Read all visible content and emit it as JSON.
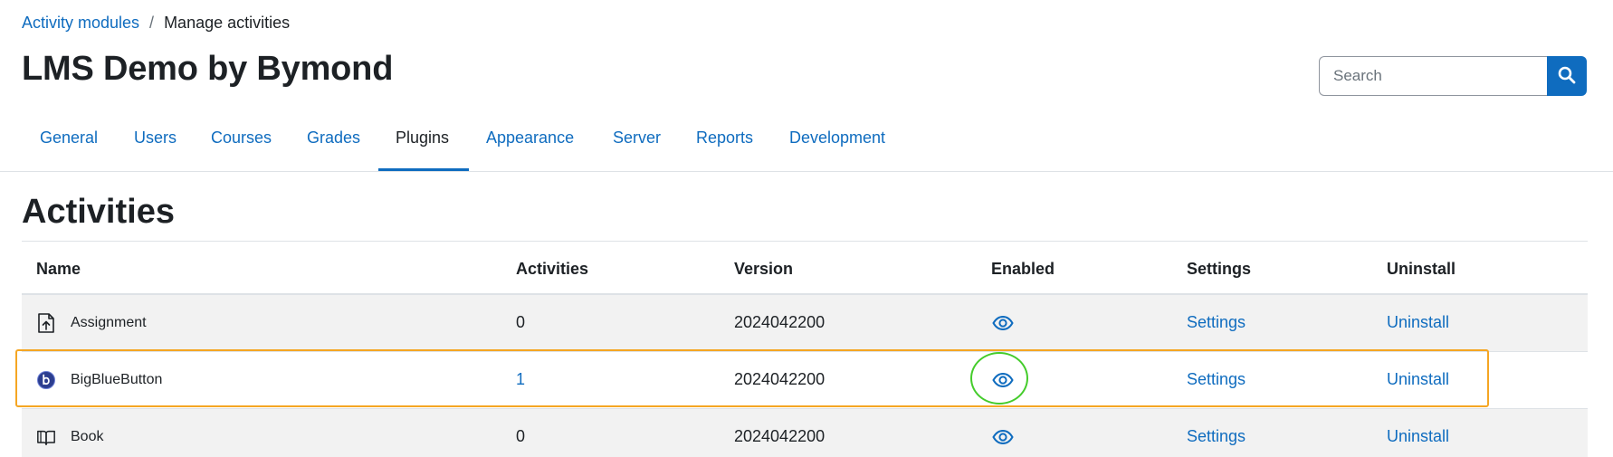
{
  "breadcrumb": {
    "items": [
      {
        "label": "Activity modules"
      },
      {
        "label": "Manage activities"
      }
    ],
    "separator": "/"
  },
  "page_title": "LMS Demo by Bymond",
  "search": {
    "placeholder": "Search",
    "icon": "search-icon"
  },
  "tabs": [
    {
      "label": "General"
    },
    {
      "label": "Users"
    },
    {
      "label": "Courses"
    },
    {
      "label": "Grades"
    },
    {
      "label": "Plugins",
      "active": true
    },
    {
      "label": "Appearance"
    },
    {
      "label": "Server"
    },
    {
      "label": "Reports"
    },
    {
      "label": "Development"
    }
  ],
  "section_title": "Activities",
  "table": {
    "columns": [
      "Name",
      "Activities",
      "Version",
      "Enabled",
      "Settings",
      "Uninstall"
    ],
    "rows": [
      {
        "name": "Assignment",
        "icon": "assignment-icon",
        "activities": "0",
        "version": "2024042200",
        "enabled_icon": "eye-icon",
        "settings": "Settings",
        "uninstall": "Uninstall"
      },
      {
        "name": "BigBlueButton",
        "icon": "bigbluebutton-icon",
        "activities": "1",
        "version": "2024042200",
        "enabled_icon": "eye-icon",
        "settings": "Settings",
        "uninstall": "Uninstall"
      },
      {
        "name": "Book",
        "icon": "book-icon",
        "activities": "0",
        "version": "2024042200",
        "enabled_icon": "eye-icon",
        "settings": "Settings",
        "uninstall": "Uninstall"
      }
    ]
  },
  "colors": {
    "link": "#0f6cbf",
    "text": "#1d2125",
    "highlight_box": "#f5a623",
    "highlight_circle": "#44cc2b",
    "row_stripe": "#f2f2f2"
  }
}
